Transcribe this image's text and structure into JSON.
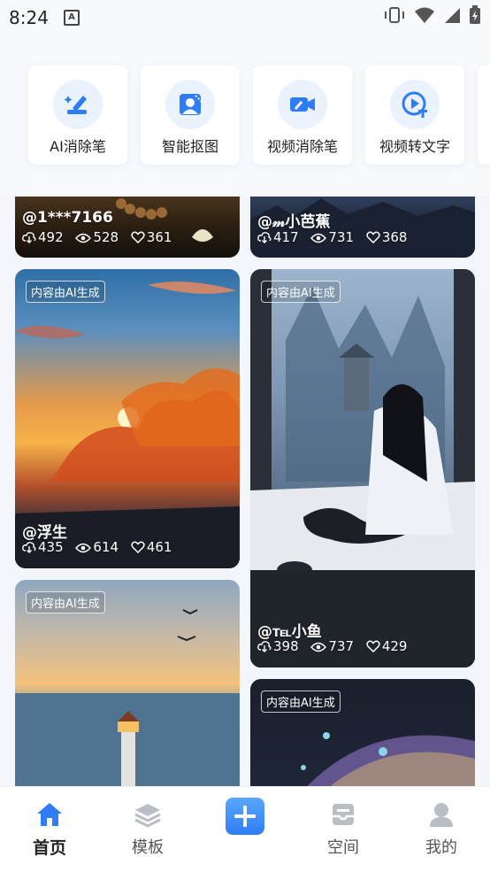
{
  "status": {
    "time": "8:24",
    "notification_icon": "A"
  },
  "tools": [
    {
      "label": "AI消除笔",
      "icon": "eraser-pen-icon"
    },
    {
      "label": "智能抠图",
      "icon": "cutout-icon"
    },
    {
      "label": "视频消除笔",
      "icon": "video-eraser-icon"
    },
    {
      "label": "视频转文字",
      "icon": "video-to-text-icon"
    }
  ],
  "feed": {
    "ai_badge": "内容由AI生成",
    "cards": [
      {
        "user": "@1***7166",
        "downloads": "492",
        "views": "528",
        "likes": "361"
      },
      {
        "user": "@𝓂小芭蕉",
        "downloads": "417",
        "views": "731",
        "likes": "368"
      },
      {
        "user": "@浮生",
        "downloads": "435",
        "views": "614",
        "likes": "461"
      },
      {
        "user": "@℡小鱼",
        "downloads": "398",
        "views": "737",
        "likes": "429"
      },
      {
        "user": "",
        "downloads": "",
        "views": "",
        "likes": ""
      },
      {
        "user": "",
        "downloads": "",
        "views": "",
        "likes": ""
      }
    ]
  },
  "tabbar": {
    "home": "首页",
    "templates": "模板",
    "add": "+",
    "space": "空间",
    "mine": "我的",
    "accent": "#2f7df6"
  }
}
